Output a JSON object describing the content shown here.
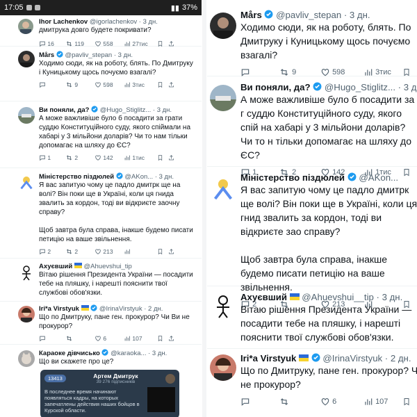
{
  "status_bar": {
    "time": "17:05",
    "battery": "37%"
  },
  "left_tweets": [
    {
      "name": "Ihor Lachenkov",
      "handle": "@igorlachenkov",
      "time": "· 3 дн.",
      "text": "дмитрука довго будете покривати?",
      "replies": "16",
      "retweets": "119",
      "likes": "558",
      "views": "27тис"
    },
    {
      "name": "Mårs",
      "handle": "@pavliv_stepan",
      "time": "· 3 дн.",
      "text": "Ходимо сюди, як на роботу, блять. По Дмитруку і Куницькому щось почуємо взагалі?",
      "replies": "",
      "retweets": "9",
      "likes": "598",
      "views": "3тис"
    },
    {
      "name": "Ви поняли, да?",
      "handle": "@Hugo_Stiglitz...",
      "time": "· 3 дн.",
      "text": "А може важливіше було б посадити за грати суддю Конституційного суду, якого спіймали на хабарі у 3 мільйони доларів? Чи то нам тільки допомагає на шляху до ЄС?",
      "replies": "1",
      "retweets": "2",
      "likes": "142",
      "views": "1тис"
    },
    {
      "name": "Міністерство піздюлей",
      "handle": "@AKon...",
      "time": "· 3 дн.",
      "text": "Я вас запитую чому це падло дмитрк ще на волі? Він поки ще в Україні, коли ця гнида звалить за кордон, тоді ви відкриєте заочну справу?\n\nЩоб завтра була справа, інакше будемо писати петицію на ваше звільнення.",
      "replies": "2",
      "retweets": "2",
      "likes": "213",
      "views": ""
    },
    {
      "name": "Ахуєвший",
      "handle": "@Ahuevshui_tip",
      "time": "· 3 дн.",
      "text": "Вітаю рішення Президента України — посадити тебе на пляшку, і нарешті пояснити твої службові обов'язки.",
      "replies": "",
      "retweets": "",
      "likes": "",
      "views": ""
    },
    {
      "name": "Iri*a Virstyuk",
      "handle": "@IrinaVirstyuk",
      "time": "· 2 дн.",
      "text": "Що по Дмитруку, пане ген. прокурор? Чи Ви не прокурор?",
      "replies": "",
      "retweets": "",
      "likes": "6",
      "views": "107"
    },
    {
      "name": "Караоке дівчисько",
      "handle": "@karaoka...",
      "time": "· 3 дн.",
      "text": "Що ви скажете про це?",
      "replies": "",
      "retweets": "",
      "likes": "",
      "views": ""
    }
  ],
  "quote_card": {
    "channel": "Артем Дмитрук",
    "subscribers": "39 276 підписників",
    "badge": "13413",
    "preview": "В последнее время начинают появляться кадры, на которых запечатлены действия наших бойцов в Курской области."
  },
  "right_tweets": [
    {
      "name": "Mårs",
      "handle": "@pavliv_stepan",
      "time": "· 3 дн.",
      "text": "Ходимо сюди, як на роботу, блять. По Дмитруку і Куницькому щось почуємо взагалі?",
      "replies": "",
      "retweets": "9",
      "likes": "598",
      "views": "3тис"
    },
    {
      "name": "Ви поняли, да?",
      "handle": "@Hugo_Stiglitz...",
      "time": "· 3 дн.",
      "text": "А може важливіше було б посадити за г суддю Конституційного суду, якого спій на хабарі у 3 мільйони доларів? Чи то н тільки допомагає на шляху до ЄС?",
      "replies": "1",
      "retweets": "2",
      "likes": "142",
      "views": "1тис"
    },
    {
      "name": "Міністерство піздюлей",
      "handle": "@AKon...",
      "time": "· 3 дн.",
      "text": "Я вас запитую чому це падло дмитрк ще волі? Він поки ще в Україні, коли ця гнид звалить за кордон, тоді ви відкриєте зао справу?\n\nЩоб завтра була справа, інакше будемо писати петицію на ваше звільнення.",
      "replies": "2",
      "retweets": "",
      "likes": "213",
      "views": ""
    },
    {
      "name": "Ахуєвший",
      "handle": "@Ahuevshui__tip",
      "time": "· 3 дн.",
      "text": "Вітаю рішення Президента України — посадити тебе на пляшку, і нарешті пояснити твої службові обов'язки.",
      "replies": "",
      "retweets": "",
      "likes": "",
      "views": ""
    },
    {
      "name": "Iri*a Virstyuk",
      "handle": "@IrinaVirstyuk",
      "time": "· 2 дн.",
      "text": "Що по Дмитруку, пане ген. прокурор? Ч не прокурор?",
      "replies": "",
      "retweets": "",
      "likes": "6",
      "views": "107"
    }
  ]
}
